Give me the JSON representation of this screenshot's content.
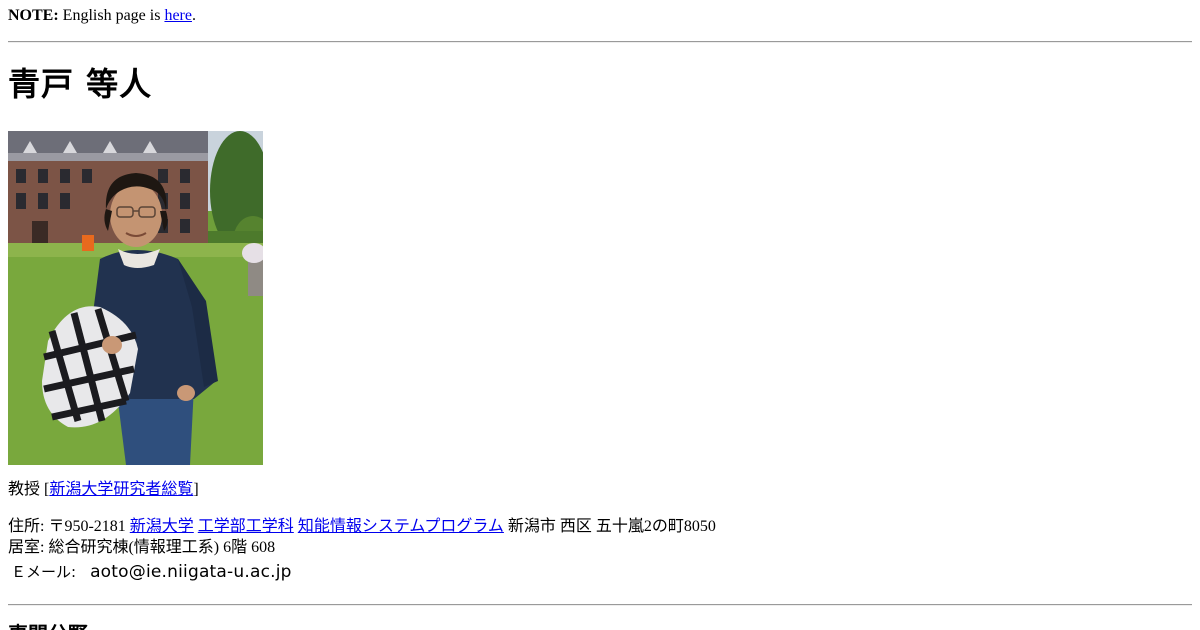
{
  "note": {
    "label": "NOTE:",
    "text": "English page is",
    "link": "here",
    "period": "."
  },
  "profile": {
    "name": "青戸 等人",
    "position": "教授",
    "bracket_open": "[",
    "researcher_link": "新潟大学研究者総覧",
    "bracket_close": "]"
  },
  "address": {
    "label": "住所: 〒950-2181",
    "university_link": "新潟大学",
    "faculty_link": "工学部工学科",
    "program_link": "知能情報システムプログラム",
    "street": "新潟市 西区 五十嵐2の町8050"
  },
  "room": {
    "text": "居室: 総合研究棟(情報理工系) 6階 608"
  },
  "email": {
    "label": "Ｅメール:",
    "address": "aoto@ie.niigata-u.ac.jp"
  },
  "next_section": {
    "heading": "専門分野"
  },
  "colors": {
    "link": "#0000ee",
    "rule": "#9a9a9a",
    "text": "#000000"
  }
}
